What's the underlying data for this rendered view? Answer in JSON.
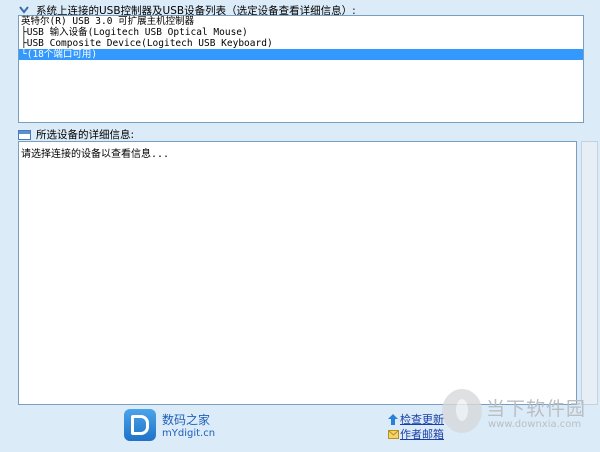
{
  "sections": {
    "device_list_label": "系统上连接的USB控制器及USB设备列表（选定设备查看详细信息）:",
    "detail_label": "所选设备的详细信息:"
  },
  "tree": [
    {
      "text": "英特尔(R) USB 3.0 可扩展主机控制器",
      "selected": false
    },
    {
      "text": "├USB 输入设备(Logitech USB Optical Mouse)",
      "selected": false
    },
    {
      "text": "├USB Composite Device(Logitech USB Keyboard)",
      "selected": false
    },
    {
      "text": "└(18个端口可用)",
      "selected": true
    }
  ],
  "detail": {
    "text": "请选择连接的设备以查看信息..."
  },
  "footer": {
    "brand_name": "数码之家",
    "brand_site": "mYdigit.cn",
    "check_update": "检查更新",
    "author_mail": "作者邮箱"
  },
  "watermark": {
    "name": "当下软件园",
    "url": "www.downxia.com"
  },
  "colors": {
    "selection": "#3399ff",
    "background": "#dcebf8",
    "link": "#1a3fa8"
  }
}
